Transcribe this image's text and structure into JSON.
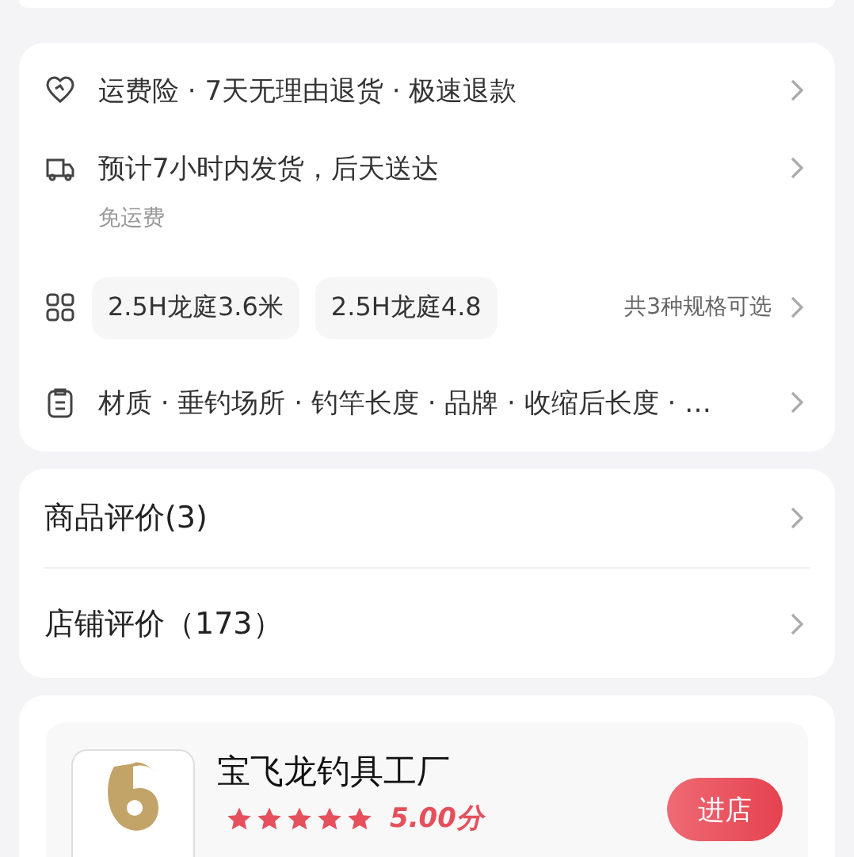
{
  "service_rows": [
    {
      "kind": "insurance",
      "text": "运费险 · 7天无理由退货 · 极速退款"
    },
    {
      "kind": "shipping",
      "text": "预计7小时内发货，后天送达",
      "subtext": "免运费"
    },
    {
      "kind": "specs",
      "chips": [
        "2.5H龙庭3.6米",
        "2.5H龙庭4.8"
      ],
      "summary": "共3种规格可选"
    },
    {
      "kind": "params",
      "text": "材质 · 垂钓场所 · 钓竿长度 · 品牌 · 收缩后长度 · …"
    }
  ],
  "reviews": [
    {
      "label": "商品评价(3)"
    },
    {
      "label": "店铺评价（173）"
    }
  ],
  "shop": {
    "name": "宝飞龙钓具工厂",
    "stars": 5,
    "score": "5.00分",
    "button": "进店"
  }
}
